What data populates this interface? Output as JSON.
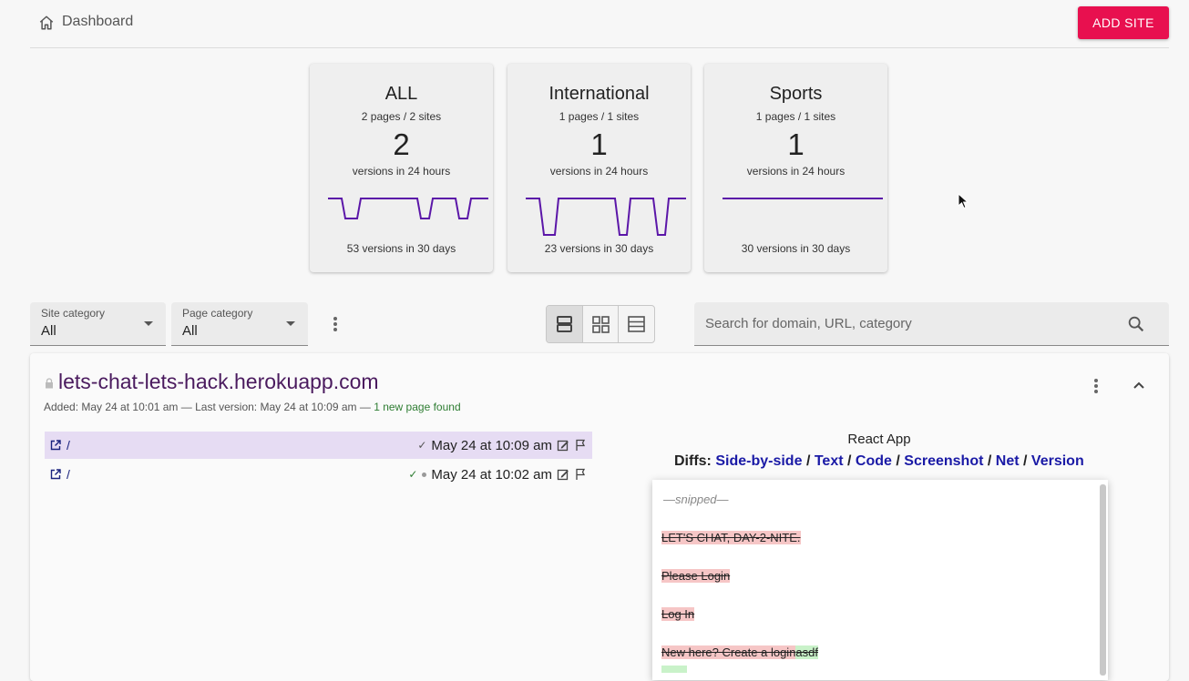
{
  "header": {
    "breadcrumb": "Dashboard",
    "add_site_label": "ADD SITE"
  },
  "cards": [
    {
      "title": "ALL",
      "pages": "2 pages / 2 sites",
      "count": "2",
      "versions_24h": "versions in 24 hours",
      "versions_30d": "53 versions in 30 days"
    },
    {
      "title": "International",
      "pages": "1 pages / 1 sites",
      "count": "1",
      "versions_24h": "versions in 24 hours",
      "versions_30d": "23 versions in 30 days"
    },
    {
      "title": "Sports",
      "pages": "1 pages / 1 sites",
      "count": "1",
      "versions_24h": "versions in 24 hours",
      "versions_30d": "30 versions in 30 days"
    }
  ],
  "filters": {
    "site_category": {
      "label": "Site category",
      "value": "All"
    },
    "page_category": {
      "label": "Page category",
      "value": "All"
    }
  },
  "search": {
    "placeholder": "Search for domain, URL, category"
  },
  "site": {
    "title": "lets-chat-lets-hack.herokuapp.com",
    "meta_prefix": "Added: May 24 at 10:01 am — Last version: May 24 at 10:09 am — ",
    "meta_new": "1 new page found",
    "pages": [
      {
        "path": "/",
        "check": "✓",
        "date": "May 24 at 10:09 am"
      },
      {
        "path": "/",
        "check": "✓",
        "date": "May 24 at 10:02 am"
      }
    ]
  },
  "diff": {
    "page_title": "React App",
    "diffs_label": "Diffs:",
    "links": [
      "Side-by-side",
      "Text",
      "Code",
      "Screenshot",
      "Net",
      "Version"
    ],
    "separator": "/",
    "snipped": "—snipped—",
    "lines": [
      "LET'S CHAT, DAY-2-NITE.",
      "Please Login",
      "Log In",
      "New here? Create a login"
    ],
    "inserted": "asdf"
  },
  "colors": {
    "accent": "#e8104f",
    "sparkline": "#5b16a8",
    "selected_row": "#e6dcf3",
    "link": "#1a1aa6"
  }
}
